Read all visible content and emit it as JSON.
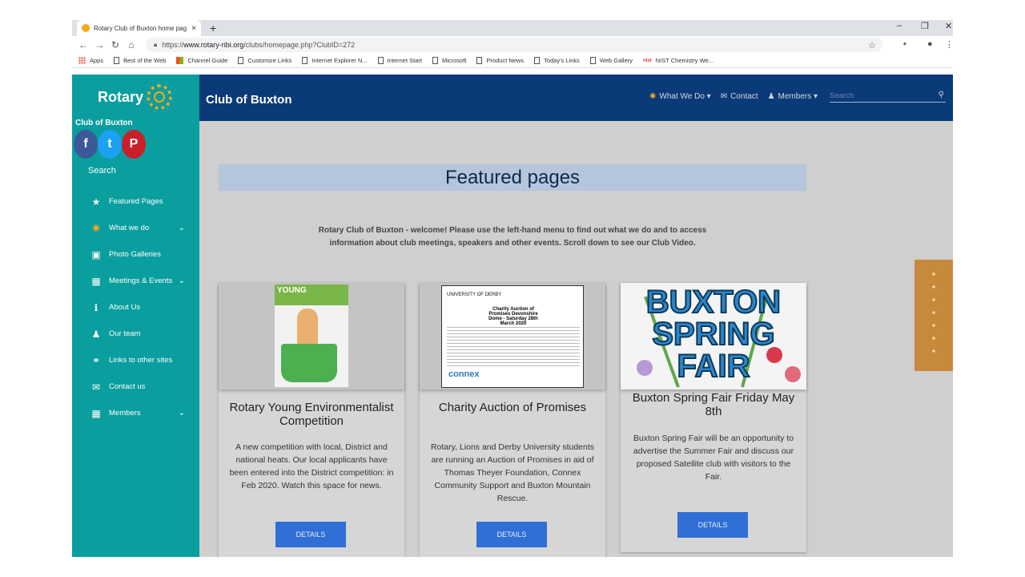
{
  "browser": {
    "tab_title": "Rotary Club of Buxton home pag",
    "new_tab": "+",
    "tab_close": "×",
    "url_prefix": "https://",
    "url_host": "www.rotary-ribi.org",
    "url_path": "/clubs/homepage.php?ClubID=272",
    "bookmarks": [
      "Apps",
      "Best of the Web",
      "Channel Guide",
      "Customize Links",
      "Internet Explorer N...",
      "Internet Start",
      "Microsoft",
      "Product News",
      "Today's Links",
      "Web Gallery",
      "NIST Chemistry We..."
    ]
  },
  "sidebar": {
    "logo_text": "Rotary",
    "club_name": "Club of Buxton",
    "social": {
      "facebook": "f",
      "twitter": "t",
      "pinterest": "P"
    },
    "search_label": "Search",
    "items": [
      {
        "label": "Featured Pages",
        "icon": "star-icon",
        "glyph": "★",
        "has_sub": false
      },
      {
        "label": "What we do",
        "icon": "rotary-wheel-icon",
        "glyph": "✺",
        "has_sub": true
      },
      {
        "label": "Photo Galleries",
        "icon": "camera-icon",
        "glyph": "▣",
        "has_sub": false
      },
      {
        "label": "Meetings & Events",
        "icon": "calendar-icon",
        "glyph": "▦",
        "has_sub": true
      },
      {
        "label": "About Us",
        "icon": "info-icon",
        "glyph": "ℹ",
        "has_sub": false
      },
      {
        "label": "Our team",
        "icon": "user-icon",
        "glyph": "♟",
        "has_sub": false
      },
      {
        "label": "Links to other sites",
        "icon": "link-icon",
        "glyph": "⚭",
        "has_sub": false
      },
      {
        "label": "Contact us",
        "icon": "envelope-icon",
        "glyph": "✉",
        "has_sub": false
      },
      {
        "label": "Members",
        "icon": "calendar-icon",
        "glyph": "▦",
        "has_sub": true
      }
    ]
  },
  "header": {
    "title": "Club of Buxton",
    "nav": [
      {
        "label": "What We Do",
        "glyph": "✺",
        "dropdown": true
      },
      {
        "label": "Contact",
        "glyph": "✉",
        "dropdown": false
      },
      {
        "label": "Members",
        "glyph": "♟",
        "dropdown": true
      }
    ],
    "search_placeholder": "Search"
  },
  "main": {
    "banner": "Featured pages",
    "welcome": "Rotary Club of Buxton - welcome! Please use the left-hand menu to find out what we do and to access information about club meetings, speakers and other events. Scroll down to see our Club Video.",
    "cards": [
      {
        "title": "Rotary Young Environmentalist Competition",
        "desc": "A new competition with local, District and national heats. Our local applicants have been entered into the District competition: in Feb 2020. Watch this space for news.",
        "button": "DETAILS",
        "thumb_text": "YOUNG"
      },
      {
        "title": "Charity Auction of Promises",
        "desc": "Rotary, Lions and Derby University students are running an Auction of Promises in aid of Thomas Theyer Foundation, Connex Community Support and Buxton Mountain Rescue.",
        "button": "DETAILS",
        "thumb_head": "UNIVERSITY OF DERBY",
        "thumb_mid": "Charity Auction of Promises Devonshire Dome - Saturday 28th March 2020",
        "thumb_logo": "connex"
      },
      {
        "title": "Buxton Spring Fair Friday May 8th",
        "desc": "Buxton Spring Fair will be an opportunity to advertise the Summer Fair and discuss our proposed Satellite club with visitors to the Fair.",
        "button": "DETAILS",
        "thumb_words": [
          "BUXTON",
          "SPRING",
          "FAIR"
        ]
      }
    ]
  }
}
